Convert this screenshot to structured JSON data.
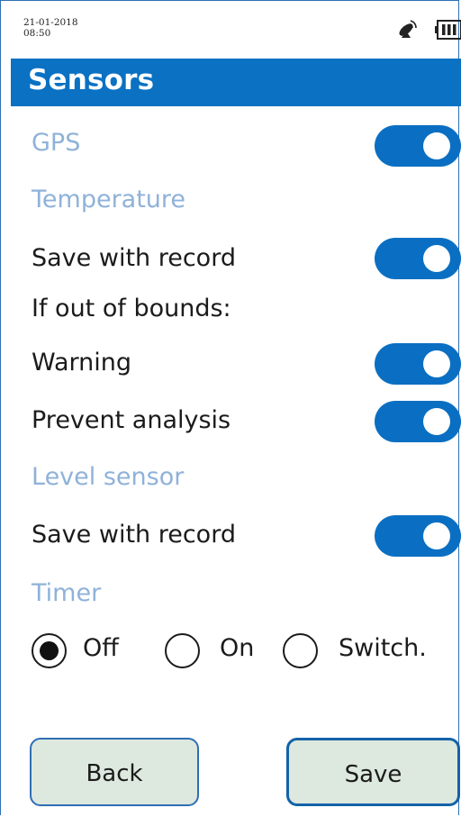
{
  "status": {
    "date": "21-01-2018",
    "time": "08:50",
    "signal_icon": "satellite-signal-icon",
    "battery_icon": "battery-icon"
  },
  "header": {
    "title": "Sensors"
  },
  "gps": {
    "label": "GPS",
    "enabled": true
  },
  "temperature": {
    "section_label": "Temperature",
    "save_with_record": {
      "label": "Save with record",
      "enabled": true
    },
    "out_of_bounds_label": "If out of bounds:",
    "warning": {
      "label": "Warning",
      "enabled": true
    },
    "prevent_analysis": {
      "label": "Prevent analysis",
      "enabled": true
    }
  },
  "level_sensor": {
    "section_label": "Level sensor",
    "save_with_record": {
      "label": "Save with record",
      "enabled": true
    }
  },
  "timer": {
    "section_label": "Timer",
    "options": [
      {
        "label": "Off",
        "selected": true
      },
      {
        "label": "On",
        "selected": false
      },
      {
        "label": "Switch.",
        "selected": false
      }
    ]
  },
  "buttons": {
    "back": "Back",
    "save": "Save"
  },
  "colors": {
    "accent": "#0a71c3",
    "section_text": "#8fb2d9",
    "button_bg": "#dde8df"
  }
}
